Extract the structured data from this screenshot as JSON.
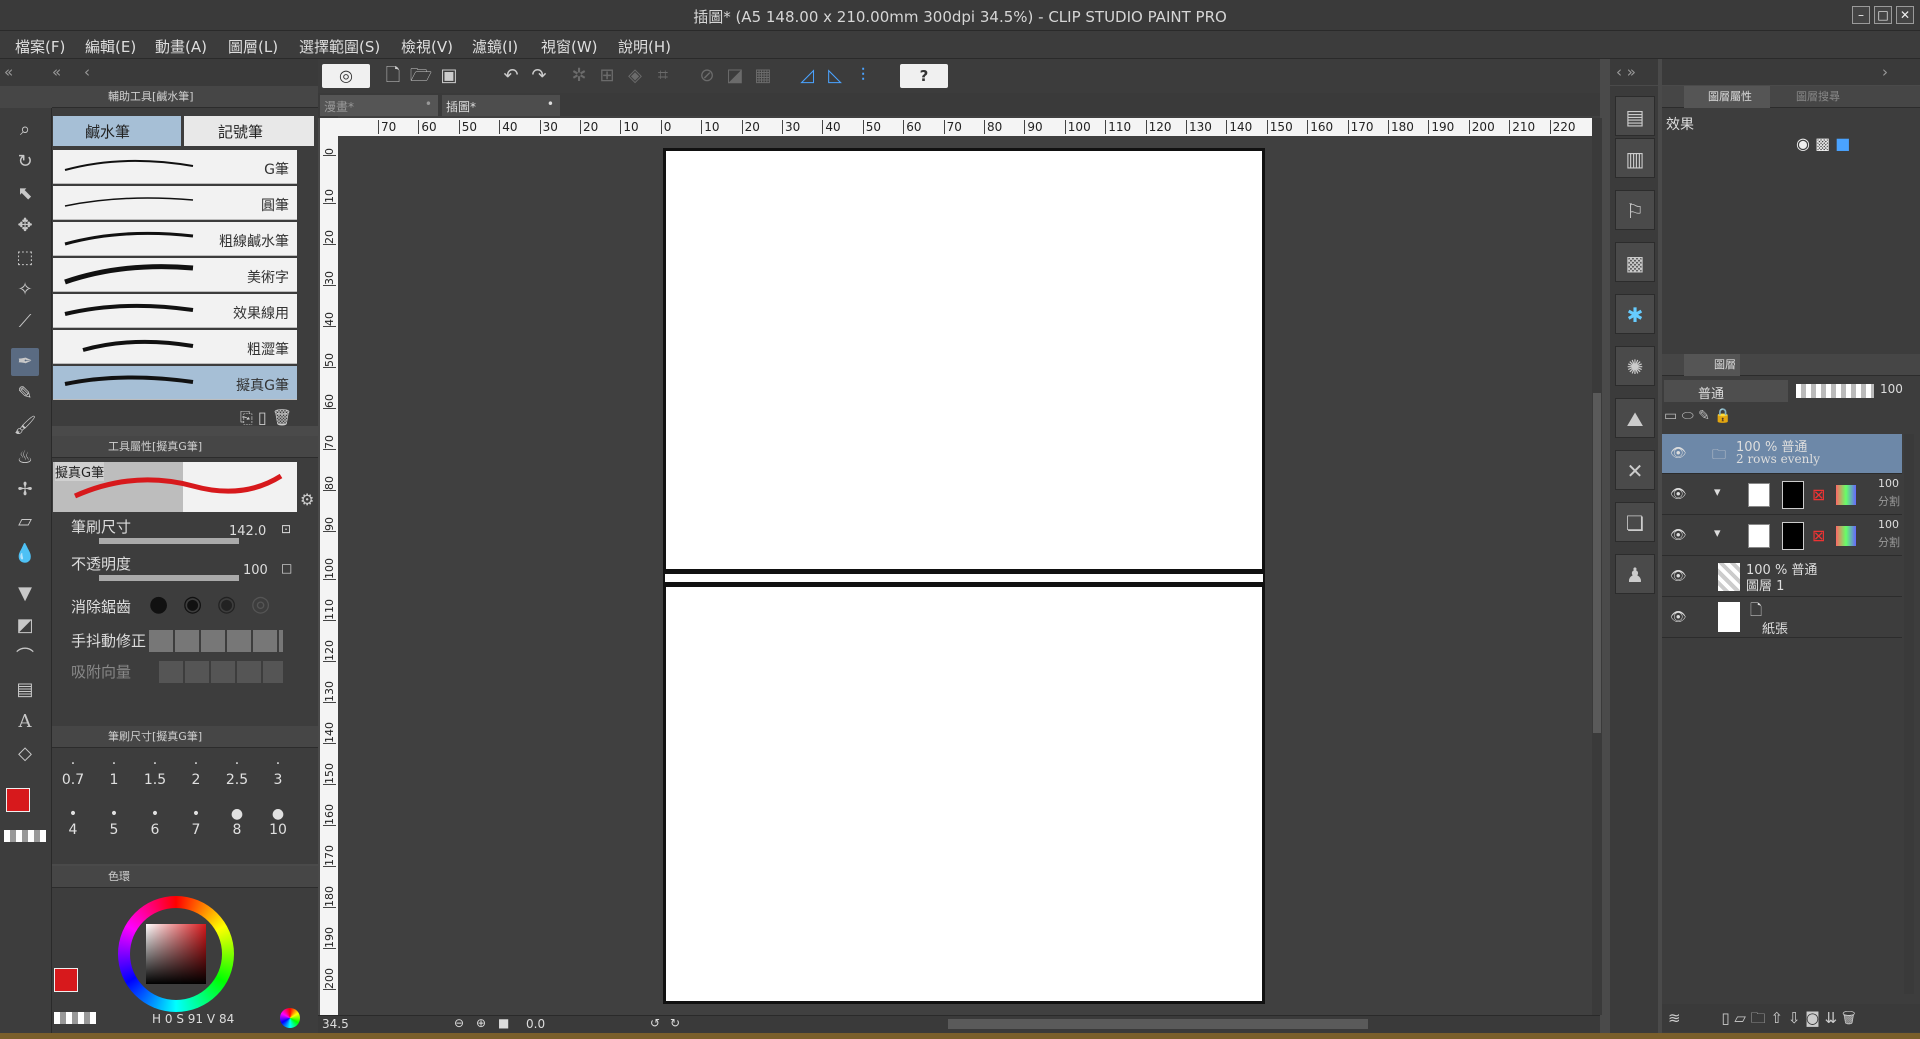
{
  "window": {
    "title": "插圖* (A5 148.00 x 210.00mm 300dpi 34.5%)  - CLIP STUDIO PAINT PRO"
  },
  "menu": [
    "檔案(F)",
    "編輯(E)",
    "動畫(A)",
    "圖層(L)",
    "選擇範圍(S)",
    "檢視(V)",
    "濾鏡(I)",
    "視窗(W)",
    "說明(H)"
  ],
  "tabs": {
    "tab1": "漫畫*",
    "tab2": "插圖*"
  },
  "subtool": {
    "header": "輔助工具[鹹水筆]",
    "group_tabs": [
      "鹹水筆",
      "記號筆"
    ],
    "brushes": [
      "G筆",
      "圓筆",
      "粗線鹹水筆",
      "美術字",
      "效果線用",
      "粗澀筆",
      "擬真G筆"
    ],
    "selected_brush": "擬真G筆"
  },
  "tool_property": {
    "header": "工具屬性[擬真G筆]",
    "preview_label": "擬真G筆",
    "brush_size_label": "筆刷尺寸",
    "brush_size_value": "142.0",
    "opacity_label": "不透明度",
    "opacity_value": "100",
    "antialias_label": "消除鋸齒",
    "stabilization_label": "手抖動修正",
    "snap_label": "吸附向量"
  },
  "brush_size_panel": {
    "header": "筆刷尺寸[擬真G筆]",
    "sizes_row1": [
      "0.7",
      "1",
      "1.5",
      "2",
      "2.5",
      "3"
    ],
    "sizes_row2": [
      "4",
      "5",
      "6",
      "7",
      "8",
      "10"
    ]
  },
  "color_panel": {
    "header": "色環",
    "hue_label": "H",
    "hue_value": "0",
    "sat_label": "S",
    "sat_value": "91",
    "val_label": "V",
    "val_value": "84",
    "main_color": "#d7191c"
  },
  "ruler_h": [
    "70",
    "60",
    "50",
    "40",
    "30",
    "20",
    "10",
    "0",
    "10",
    "20",
    "30",
    "40",
    "50",
    "60",
    "70",
    "80",
    "90",
    "100",
    "110",
    "120",
    "130",
    "140",
    "150",
    "160",
    "170",
    "180",
    "190",
    "200",
    "210",
    "220"
  ],
  "ruler_v": [
    "0",
    "10",
    "20",
    "30",
    "40",
    "50",
    "60",
    "70",
    "80",
    "90",
    "100",
    "110",
    "120",
    "130",
    "140",
    "150",
    "160",
    "170",
    "180",
    "190",
    "200"
  ],
  "status": {
    "zoom": "34.5",
    "angle": "0.0"
  },
  "layer_property": {
    "header_tab1": "圖層屬性",
    "header_tab2": "圖層搜尋",
    "effect_label": "效果"
  },
  "layer_panel": {
    "header": "圖層",
    "blend_mode": "普通",
    "opacity": "100",
    "layers": [
      {
        "name_line1": "100 % 普通",
        "name_line2": "2 rows evenly"
      },
      {
        "opacity": "100",
        "mode": "分割"
      },
      {
        "opacity": "100",
        "mode": "分割"
      },
      {
        "name_line1": "100 % 普通",
        "name_line2": "圖層 1"
      },
      {
        "name_line1": "",
        "name_line2": "紙張"
      }
    ]
  }
}
